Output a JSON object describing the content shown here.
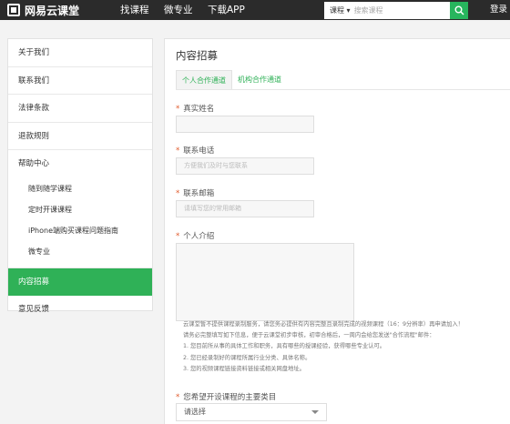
{
  "header": {
    "brand": "网易云课堂",
    "nav": [
      "找课程",
      "微专业",
      "下载APP"
    ],
    "search_category": "课程",
    "search_placeholder": "搜索课程",
    "login": "登录"
  },
  "sidebar": {
    "items": [
      {
        "label": "关于我们"
      },
      {
        "label": "联系我们"
      },
      {
        "label": "法律条款"
      },
      {
        "label": "退款规则"
      },
      {
        "label": "帮助中心"
      },
      {
        "label": "随到随学课程"
      },
      {
        "label": "定时开课课程"
      },
      {
        "label": "iPhone端购买课程问题指南"
      },
      {
        "label": "微专业"
      },
      {
        "label": "内容招募"
      },
      {
        "label": "意见反馈"
      }
    ]
  },
  "main": {
    "title": "内容招募",
    "tabs": [
      "个人合作通道",
      "机构合作通道"
    ],
    "form": {
      "name_label": "真实姓名",
      "phone_label": "联系电话",
      "phone_placeholder": "方便我们及时与您联系",
      "email_label": "联系邮箱",
      "email_placeholder": "请填写您的常用邮箱",
      "intro_label": "个人介绍",
      "notes": [
        "云课堂暂不提供课程录制服务，请您务必提供有内容完整且录制完成的视频课程（16：9分辨率）再申请加入！",
        "请务必完整填写如下信息，便于云课堂初步审核，初审合格后，一周内会给您发送\"合作流程\"邮件：",
        "1. 您目前所从事的具体工作和职务，具有哪些的授课经验，获得哪些专业认可。",
        "2. 您已经录制好的课程所属行业分类、具体名称。",
        "3. 您的视频课程链接资料链接或相关网盘地址。"
      ],
      "category_label": "您希望开设课程的主要类目",
      "category_value": "请选择"
    }
  },
  "colors": {
    "accent": "#2fb157",
    "topbar": "#2b2b2b",
    "required": "#e05a2b"
  }
}
